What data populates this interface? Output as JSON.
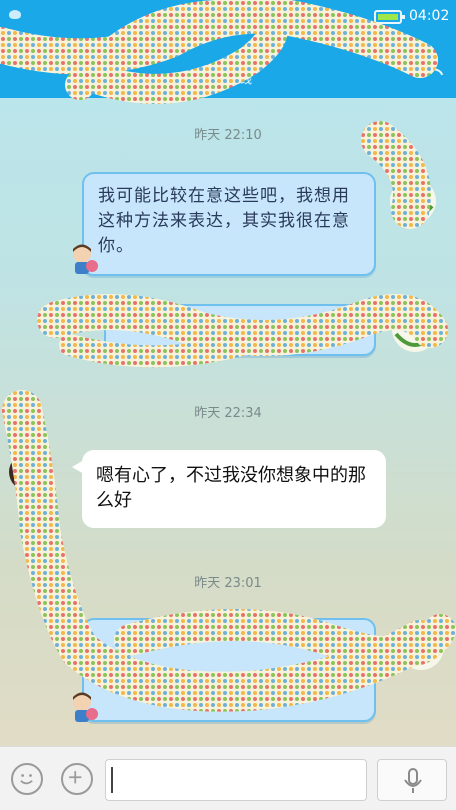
{
  "status": {
    "time": "04:02",
    "subtitle": "手机在线"
  },
  "messages": [
    {
      "timestamp": "昨天 22:10"
    },
    {
      "side": "right",
      "text": "我可能比较在意这些吧，我想用这种方法来表达，其实我很在意你。"
    },
    {
      "side": "right",
      "text": ""
    },
    {
      "timestamp": "昨天 22:34"
    },
    {
      "side": "left",
      "text": "嗯有心了，不过我没你想象中的那么好"
    },
    {
      "timestamp": "昨天 23:01"
    },
    {
      "side": "right",
      "text": ""
    }
  ],
  "input": {
    "placeholder": ""
  },
  "icons": {
    "emoji": "emoji-icon",
    "add": "plus-circle-icon",
    "voice": "microphone-icon",
    "profile": "person-icon"
  },
  "colors": {
    "topbar": "#1aa8e8",
    "bubble_blue": "#c7e6fb",
    "bubble_border": "#6fc0ef"
  }
}
